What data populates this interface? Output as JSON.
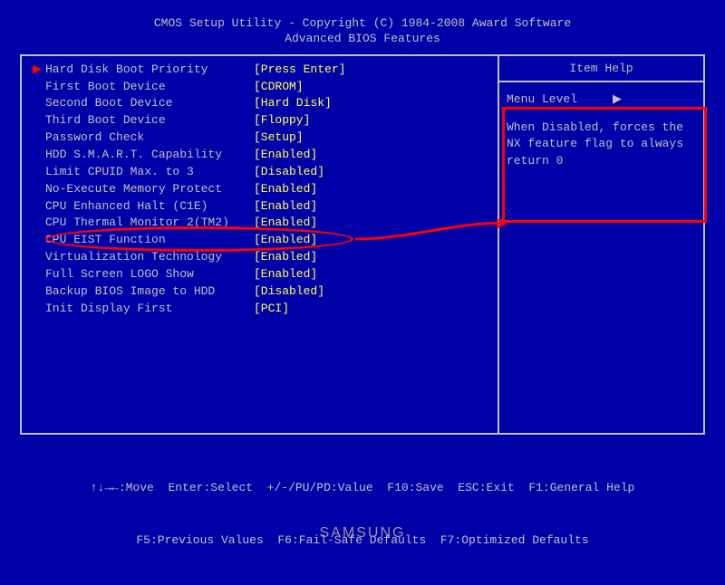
{
  "header": {
    "line1": "CMOS Setup Utility - Copyright (C) 1984-2008 Award Software",
    "line2": "Advanced BIOS Features"
  },
  "rows": [
    {
      "pointer": "▶",
      "label": "Hard Disk Boot Priority",
      "value": "[Press Enter]"
    },
    {
      "pointer": "",
      "label": "First Boot Device",
      "value": "[CDROM]"
    },
    {
      "pointer": "",
      "label": "Second Boot Device",
      "value": "[Hard Disk]"
    },
    {
      "pointer": "",
      "label": "Third Boot Device",
      "value": "[Floppy]"
    },
    {
      "pointer": "",
      "label": "Password Check",
      "value": "[Setup]"
    },
    {
      "pointer": "",
      "label": "HDD S.M.A.R.T. Capability",
      "value": "[Enabled]"
    },
    {
      "pointer": "",
      "label": "Limit CPUID Max. to 3",
      "value": "[Disabled]"
    },
    {
      "pointer": "",
      "label": "No-Execute Memory Protect",
      "value": "[Enabled]"
    },
    {
      "pointer": "",
      "label": "CPU Enhanced Halt (C1E)",
      "value": "[Enabled]"
    },
    {
      "pointer": "",
      "label": "CPU Thermal Monitor 2(TM2)",
      "value": "[Enabled]"
    },
    {
      "pointer": "",
      "label": "CPU EIST Function",
      "value": "[Enabled]"
    },
    {
      "pointer": "",
      "label": "Virtualization Technology",
      "value": "[Enabled]"
    },
    {
      "pointer": "",
      "label": "Full Screen LOGO Show",
      "value": "[Enabled]"
    },
    {
      "pointer": "",
      "label": "Backup BIOS Image to HDD",
      "value": "[Disabled]"
    },
    {
      "pointer": "",
      "label": "Init Display First",
      "value": "[PCI]"
    }
  ],
  "help": {
    "title": "Item Help",
    "menu_level_label": "Menu Level",
    "menu_level_arrow": "▶",
    "desc": "When Disabled, forces the NX feature flag to always return 0"
  },
  "footer": {
    "line1": "↑↓→←:Move  Enter:Select  +/-/PU/PD:Value  F10:Save  ESC:Exit  F1:General Help",
    "line2": "F5:Previous Values  F6:Fail-Safe Defaults  F7:Optimized Defaults"
  },
  "brand": "SAMSUNG"
}
